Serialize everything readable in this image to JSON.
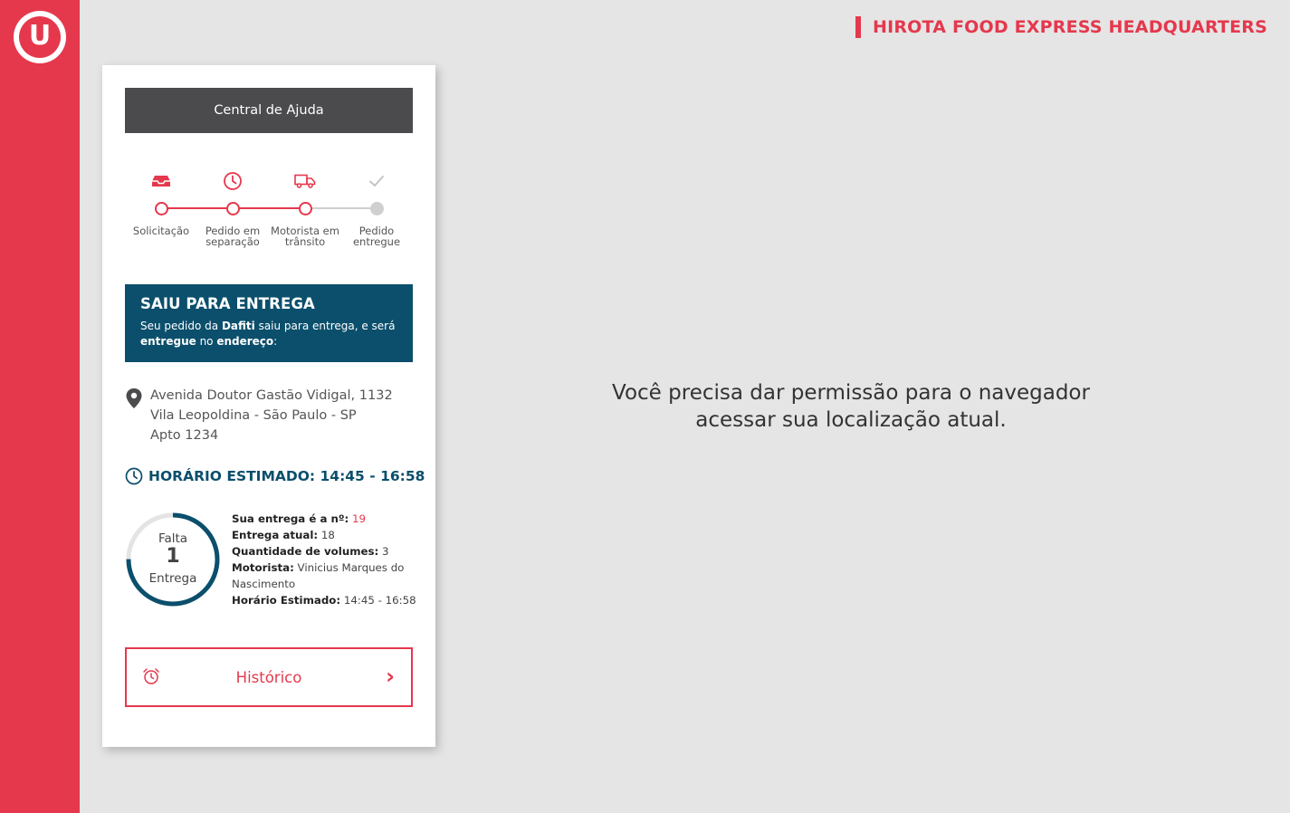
{
  "brand": {
    "logo_letter": "U",
    "header_title": "HIROTA FOOD EXPRESS HEADQUARTERS",
    "accent_color": "#e5384d",
    "primary_color": "#0b4f6c"
  },
  "help_button": {
    "label": "Central de Ajuda"
  },
  "progress": {
    "steps": [
      {
        "label": "Solicitação",
        "icon": "inbox-icon",
        "state": "done"
      },
      {
        "label": "Pedido em separação",
        "icon": "clock-icon",
        "state": "done"
      },
      {
        "label": "Motorista em trânsito",
        "icon": "truck-icon",
        "state": "current"
      },
      {
        "label": "Pedido entregue",
        "icon": "check-icon",
        "state": "pending"
      }
    ]
  },
  "status": {
    "title": "SAIU PARA ENTREGA",
    "text_1": "Seu pedido da ",
    "store": "Dafiti",
    "text_2": " saiu para entrega, e será ",
    "emph_1": "entregue",
    "text_3": " no ",
    "emph_2": "endereço",
    "text_4": ":"
  },
  "address": {
    "line1": "Avenida Doutor Gastão Vidigal, 1132",
    "line2": "Vila Leopoldina - São Paulo - SP",
    "line3": "Apto 1234"
  },
  "eta": {
    "label": "HORÁRIO ESTIMADO: 14:45 - 16:58"
  },
  "remaining": {
    "prefix": "Falta",
    "count": "1",
    "suffix": "Entrega",
    "progress_fraction": 0.75
  },
  "details": {
    "position_label": "Sua entrega é a nº:",
    "position_value": "19",
    "current_label": "Entrega atual:",
    "current_value": "18",
    "volumes_label": "Quantidade de volumes:",
    "volumes_value": "3",
    "driver_label": "Motorista:",
    "driver_value": "Vinicius Marques do Nascimento",
    "time_label": "Horário Estimado:",
    "time_value": "14:45 - 16:58"
  },
  "history_button": {
    "label": "Histórico",
    "chevron": "›"
  },
  "map_message": {
    "line1": "Você precisa dar permissão para o navegador",
    "line2": "acessar sua localização atual."
  }
}
